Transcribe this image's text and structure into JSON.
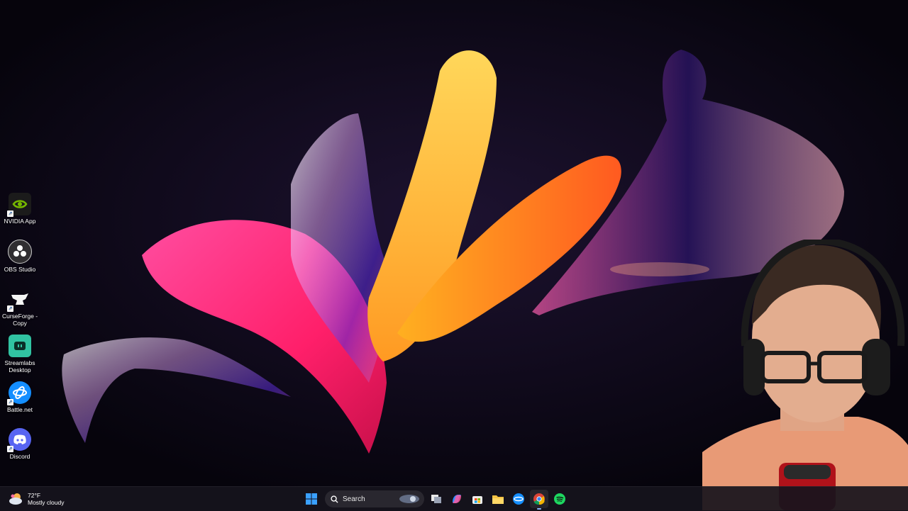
{
  "desktop": {
    "icons": [
      {
        "label": "NVIDIA App",
        "icon": "nvidia-icon"
      },
      {
        "label": "OBS Studio",
        "icon": "obs-icon"
      },
      {
        "label": "CurseForge - Copy",
        "icon": "curseforge-icon"
      },
      {
        "label": "Streamlabs Desktop",
        "icon": "streamlabs-icon"
      },
      {
        "label": "Battle.net",
        "icon": "battlenet-icon"
      },
      {
        "label": "Discord",
        "icon": "discord-icon"
      }
    ]
  },
  "taskbar": {
    "weather": {
      "temp": "72°F",
      "condition": "Mostly cloudy"
    },
    "search_label": "Search",
    "apps": [
      "windows-start-icon",
      "task-view-icon",
      "copilot-icon",
      "store-icon",
      "file-explorer-icon",
      "battlenet-taskbar-icon",
      "chrome-icon",
      "spotify-icon"
    ]
  },
  "colors": {
    "background": "#0b0714",
    "taskbar": "#16141c",
    "accent_blue": "#0078d4",
    "petal_pink": "#ff2f7a",
    "petal_orange": "#ff7a1a",
    "petal_yellow": "#ffc83a"
  }
}
